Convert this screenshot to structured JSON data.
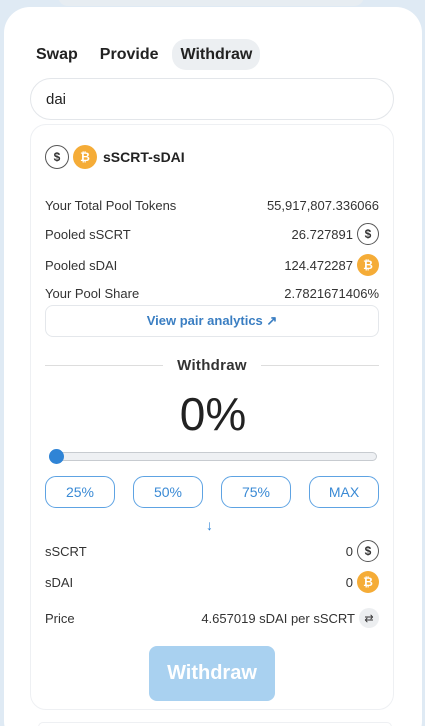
{
  "tabs": [
    {
      "label": "Swap"
    },
    {
      "label": "Provide"
    },
    {
      "label": "Withdraw"
    }
  ],
  "search": {
    "value": "dai"
  },
  "pair": {
    "name": "sSCRT-sDAI",
    "icon_a": "scrt-coin-icon",
    "icon_b": "dai-coin-icon"
  },
  "stats": {
    "total_tokens_label": "Your Total Pool Tokens",
    "total_tokens_value": "55,917,807.336066",
    "pooled_a_label": "Pooled sSCRT",
    "pooled_a_value": "26.727891",
    "pooled_b_label": "Pooled sDAI",
    "pooled_b_value": "124.472287",
    "share_label": "Your Pool Share",
    "share_value": "2.7821671406%"
  },
  "analytics_label": "View pair analytics ↗",
  "withdraw_section": {
    "heading": "Withdraw",
    "percent_display": "0%",
    "slider_value": 0,
    "quick_buttons": [
      "25%",
      "50%",
      "75%",
      "MAX"
    ],
    "arrow": "↓"
  },
  "receive": {
    "a_label": "sSCRT",
    "a_value": "0",
    "b_label": "sDAI",
    "b_value": "0"
  },
  "price": {
    "label": "Price",
    "value": "4.657019 sDAI per sSCRT",
    "toggle_icon": "swap-direction-icon"
  },
  "submit_label": "Withdraw",
  "colors": {
    "accent": "#2f84d6",
    "button_disabled": "#a9d1f0",
    "dai": "#f5ac37",
    "background": "#dfeaf4"
  }
}
